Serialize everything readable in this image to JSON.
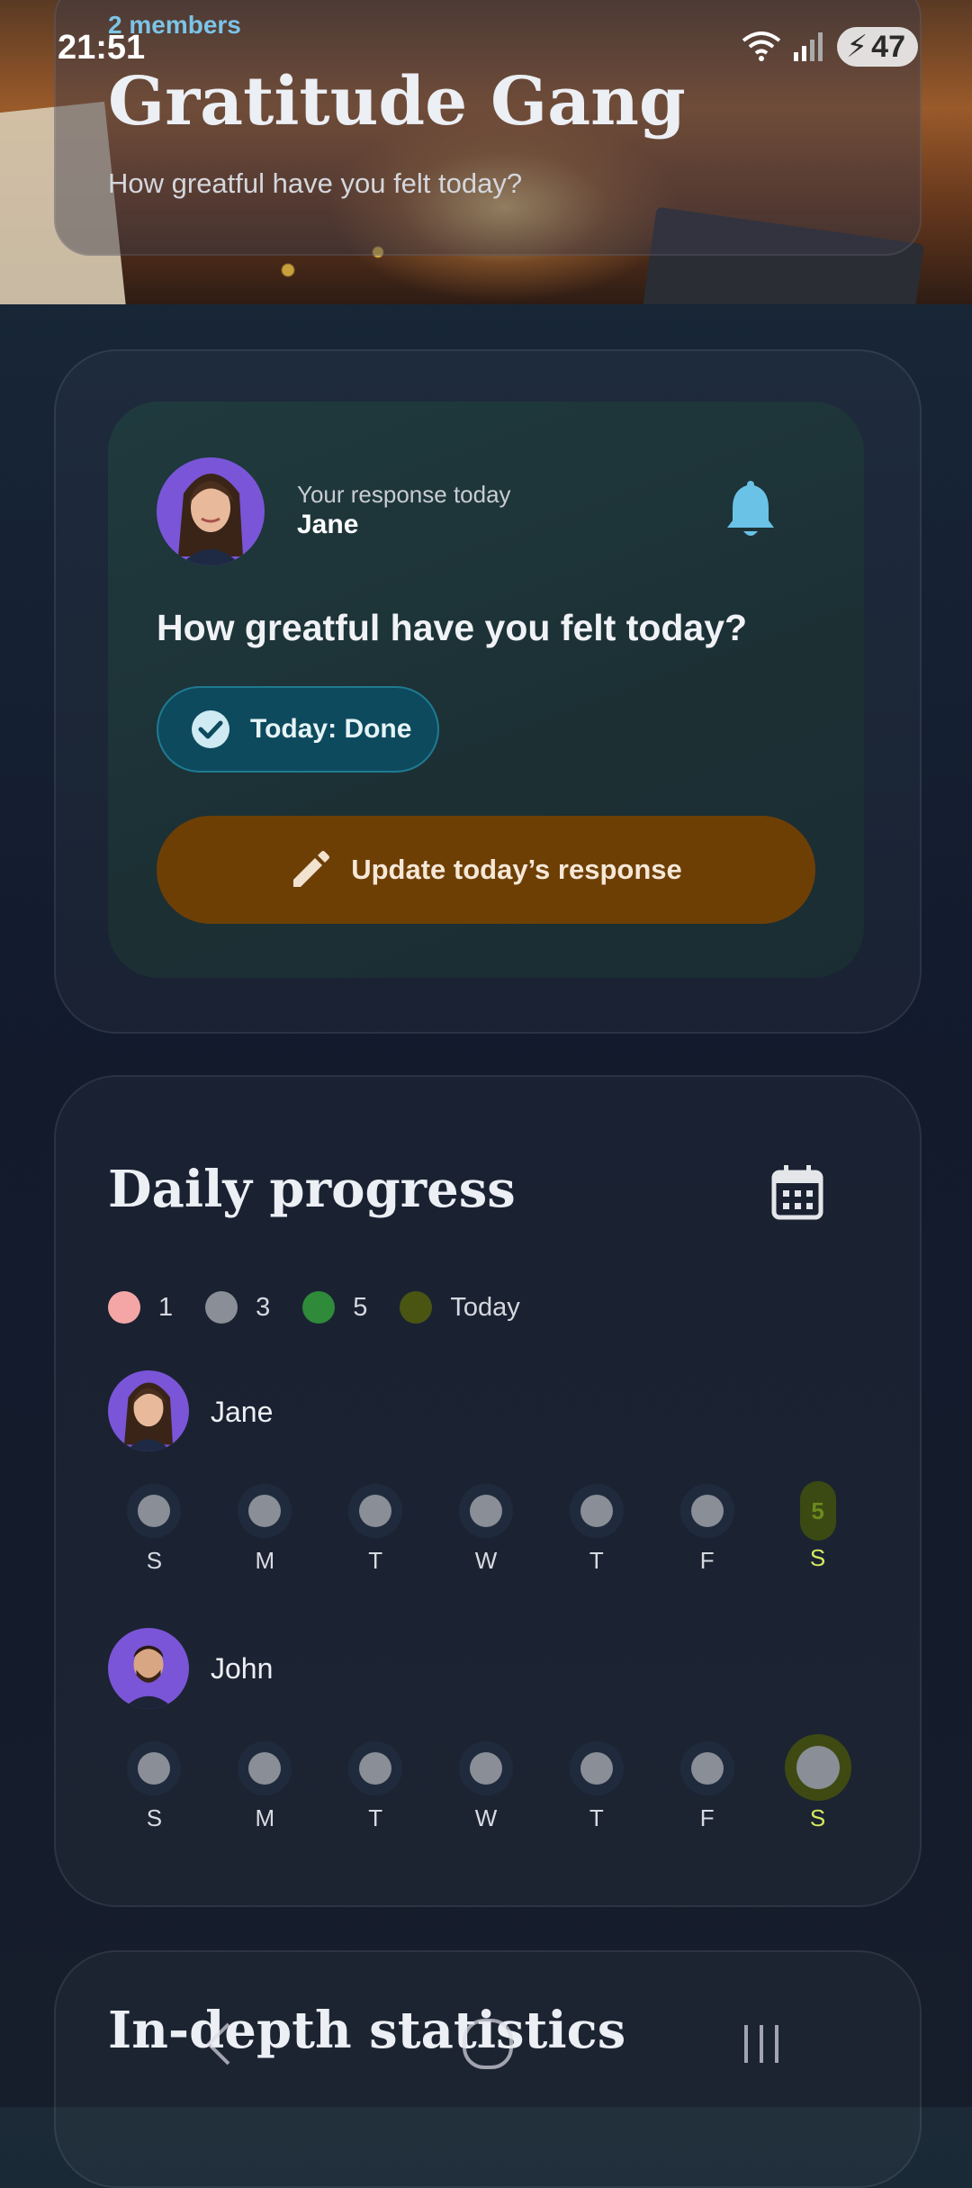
{
  "status_bar": {
    "time": "21:51",
    "battery": "47"
  },
  "group": {
    "members": "2 members",
    "title": "Gratitude Gang",
    "subtitle": "How greatful have you felt today?"
  },
  "response_card": {
    "label": "Your response today",
    "name": "Jane",
    "question": "How greatful have you felt today?",
    "status_chip": "Today: Done",
    "update_button": "Update today’s response"
  },
  "daily_progress": {
    "title": "Daily progress",
    "legend": [
      {
        "label": "1",
        "color": "#f4a6a6"
      },
      {
        "label": "3",
        "color": "#8a8e96"
      },
      {
        "label": "5",
        "color": "#2f8a3a"
      },
      {
        "label": "Today",
        "color": "#4a5512"
      }
    ],
    "members": [
      {
        "name": "Jane",
        "days": [
          "S",
          "M",
          "T",
          "W",
          "T",
          "F",
          "S"
        ],
        "today_value": "5"
      },
      {
        "name": "John",
        "days": [
          "S",
          "M",
          "T",
          "W",
          "T",
          "F",
          "S"
        ]
      }
    ]
  },
  "in_depth": {
    "title": "In-depth statistics"
  },
  "colors": {
    "accent": "#7cc4e8",
    "button": "#6e3f05",
    "chip": "#0d4a5e",
    "today": "#d6e860"
  },
  "icons": [
    "wifi-icon",
    "signal-icon",
    "bell-icon",
    "check-circle-icon",
    "pencil-icon",
    "calendar-icon",
    "back-icon",
    "home-icon",
    "recents-icon"
  ]
}
